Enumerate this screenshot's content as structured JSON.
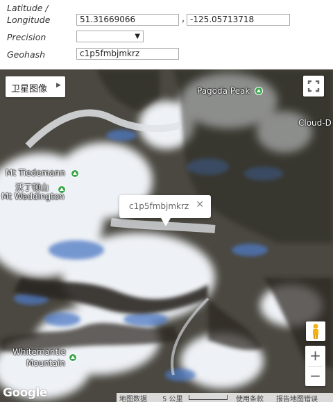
{
  "form": {
    "latlng_label_1": "Latitude /",
    "latlng_label_2": "Longitude",
    "latitude_value": "51.31669066",
    "separator": ",",
    "longitude_value": "-125.05713718",
    "precision_label": "Precision",
    "precision_value": "",
    "geohash_label": "Geohash",
    "geohash_value": "c1p5fmbjmkrz"
  },
  "map": {
    "map_type_label": "卫星图像",
    "places": [
      "Pagoda Peak",
      "Cloud-D",
      "Mt Tiedemann",
      "沃丁顿山",
      "Mt Waddington",
      "Whitemantle",
      "Mountain"
    ],
    "infowindow_text": "c1p5fmbjmkrz",
    "close_glyph": "✕",
    "zoom_in": "+",
    "zoom_out": "−",
    "logo": "Google",
    "attribution": {
      "map_data": "地图数据",
      "scale": "5 公里",
      "terms": "使用条款",
      "report": "报告地图错误"
    },
    "icons": [
      "map-type-dropdown-icon",
      "fullscreen-icon",
      "peak-marker-icon",
      "pegman-icon",
      "close-icon"
    ]
  }
}
